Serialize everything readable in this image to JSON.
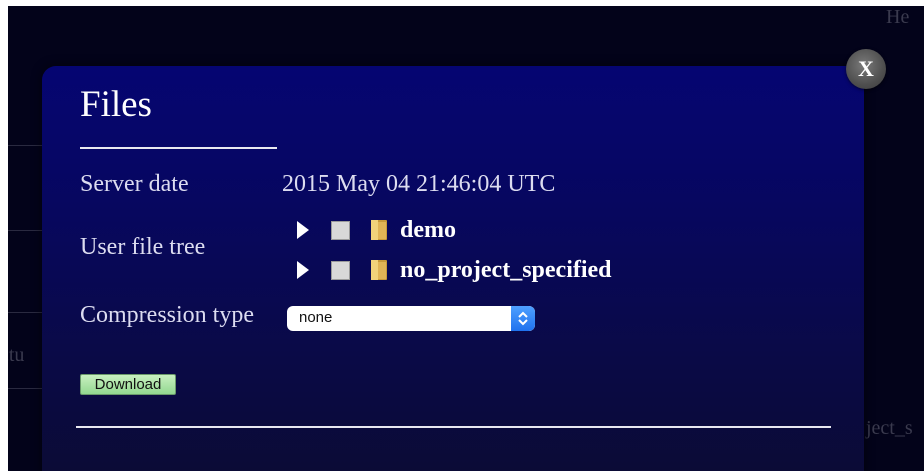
{
  "background": {
    "help_text": "He",
    "left_text": "ctu",
    "right_text": "ject_s"
  },
  "dialog": {
    "title": "Files",
    "close_label": "X",
    "server_date_label": "Server date",
    "server_date_value": "2015 May 04 21:46:04 UTC",
    "user_file_tree_label": "User file tree",
    "file_tree": [
      {
        "name": "demo",
        "icon": "folder-icon",
        "checked": false,
        "expanded": false
      },
      {
        "name": "no_project_specified",
        "icon": "folder-icon",
        "checked": false,
        "expanded": false
      }
    ],
    "compression_type_label": "Compression type",
    "compression_type_value": "none",
    "download_label": "Download"
  },
  "colors": {
    "dialog_top": "#050572",
    "dialog_bottom": "#0b0b34",
    "download_button": "#93d890",
    "select_arrow": "#1f72ee"
  }
}
